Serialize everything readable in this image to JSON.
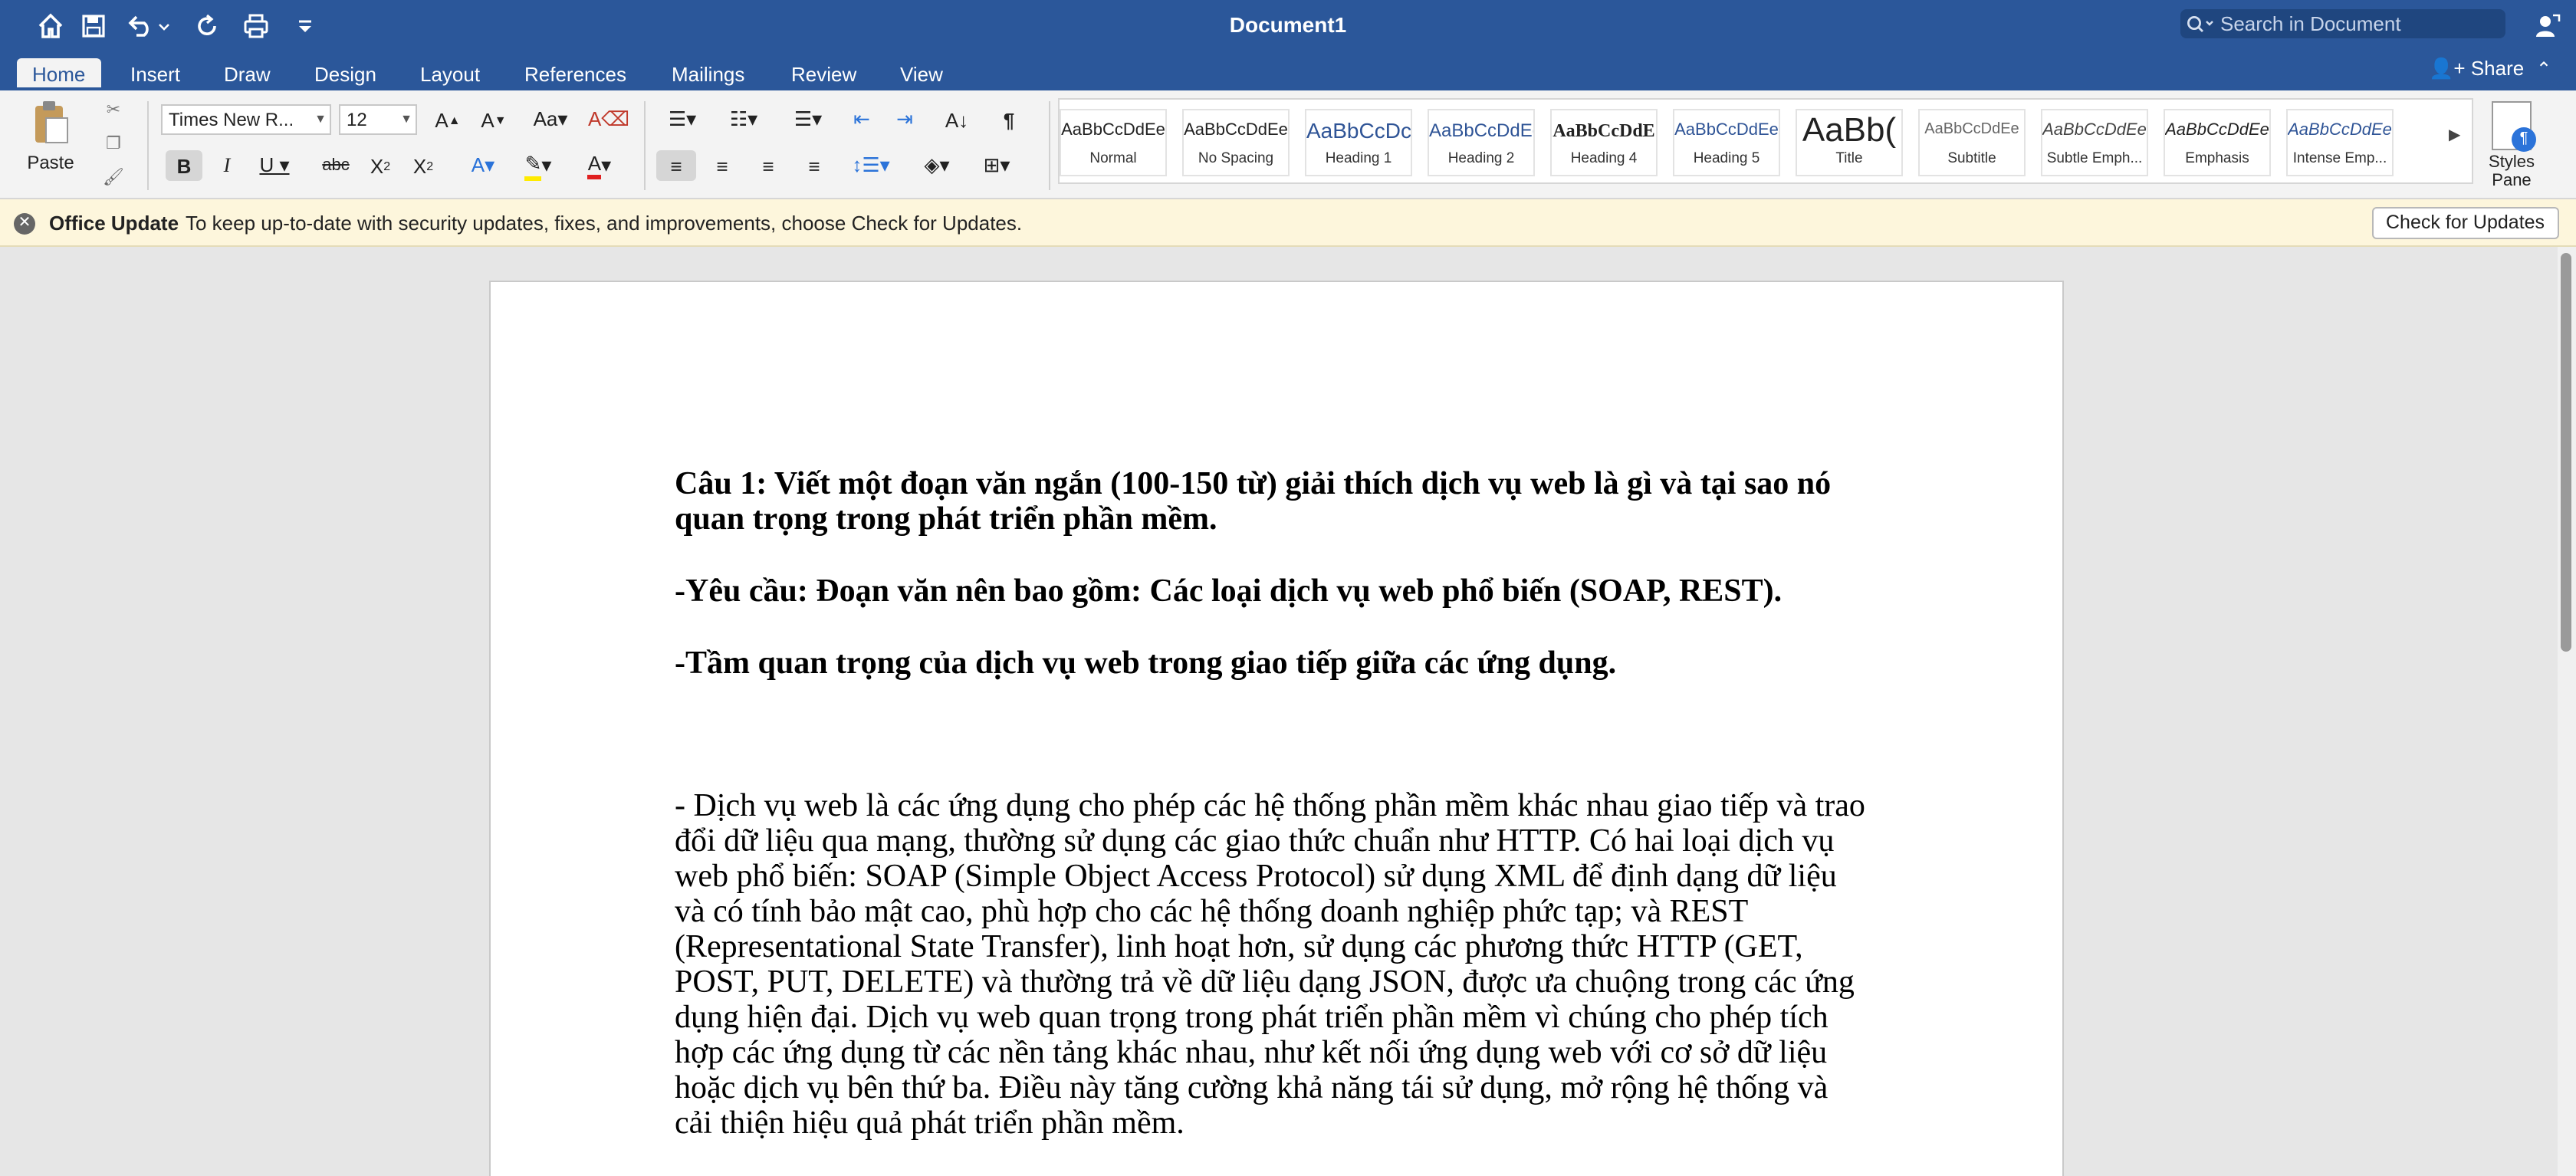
{
  "window": {
    "title": "Document1",
    "search_placeholder": "Search in Document"
  },
  "tabs": [
    "Home",
    "Insert",
    "Draw",
    "Design",
    "Layout",
    "References",
    "Mailings",
    "Review",
    "View"
  ],
  "share_label": "Share",
  "ribbon": {
    "paste_label": "Paste",
    "font_name": "Times New R...",
    "font_size": "12",
    "styles": [
      {
        "sample": "AaBbCcDdEe",
        "name": "Normal"
      },
      {
        "sample": "AaBbCcDdEe",
        "name": "No Spacing"
      },
      {
        "sample": "AaBbCcDc",
        "name": "Heading 1"
      },
      {
        "sample": "AaBbCcDdEe",
        "name": "Heading 2"
      },
      {
        "sample": "AaBbCcDdE",
        "name": "Heading 4"
      },
      {
        "sample": "AaBbCcDdEe",
        "name": "Heading 5"
      },
      {
        "sample": "AaBb(",
        "name": "Title"
      },
      {
        "sample": "AaBbCcDdEe",
        "name": "Subtitle"
      },
      {
        "sample": "AaBbCcDdEe",
        "name": "Subtle Emph..."
      },
      {
        "sample": "AaBbCcDdEe",
        "name": "Emphasis"
      },
      {
        "sample": "AaBbCcDdEe",
        "name": "Intense Emp..."
      }
    ],
    "styles_pane_label_1": "Styles",
    "styles_pane_label_2": "Pane"
  },
  "update_bar": {
    "title": "Office Update",
    "message": "To keep up-to-date with security updates, fixes, and improvements, choose Check for Updates.",
    "button": "Check for Updates"
  },
  "document": {
    "heading_1": "Câu 1: Viết một đoạn văn ngắn (100-150 từ) giải thích dịch vụ web là gì và tại sao nó quan trọng trong phát triển phần mềm.",
    "heading_2": "-Yêu cầu: Đoạn văn nên bao gồm: Các loại dịch vụ web phổ biến (SOAP, REST).",
    "heading_3": "-Tầm quan trọng của dịch vụ web trong giao tiếp giữa các ứng dụng.",
    "paragraph": "- Dịch vụ web là các ứng dụng cho phép các hệ thống phần mềm khác nhau giao tiếp và trao đổi dữ liệu qua mạng, thường sử dụng các giao thức chuẩn như HTTP. Có hai loại dịch vụ web phổ biến: SOAP (Simple Object Access Protocol) sử dụng XML để định dạng dữ liệu và có tính bảo mật cao, phù hợp cho các hệ thống doanh nghiệp phức tạp; và REST (Representational State Transfer), linh hoạt hơn, sử dụng các phương thức HTTP (GET, POST, PUT, DELETE) và thường trả về dữ liệu dạng JSON, được ưa chuộng trong các ứng dụng hiện đại. Dịch vụ web quan trọng trong phát triển phần mềm vì chúng cho phép tích hợp các ứng dụng từ các nền tảng khác nhau, như kết nối ứng dụng web với cơ sở dữ liệu hoặc dịch vụ bên thứ ba. Điều này tăng cường khả năng tái sử dụng, mở rộng hệ thống và cải thiện hiệu quả phát triển phần mềm."
  },
  "colors": {
    "brand": "#2b579a",
    "update_bar": "#fdf6dc"
  }
}
